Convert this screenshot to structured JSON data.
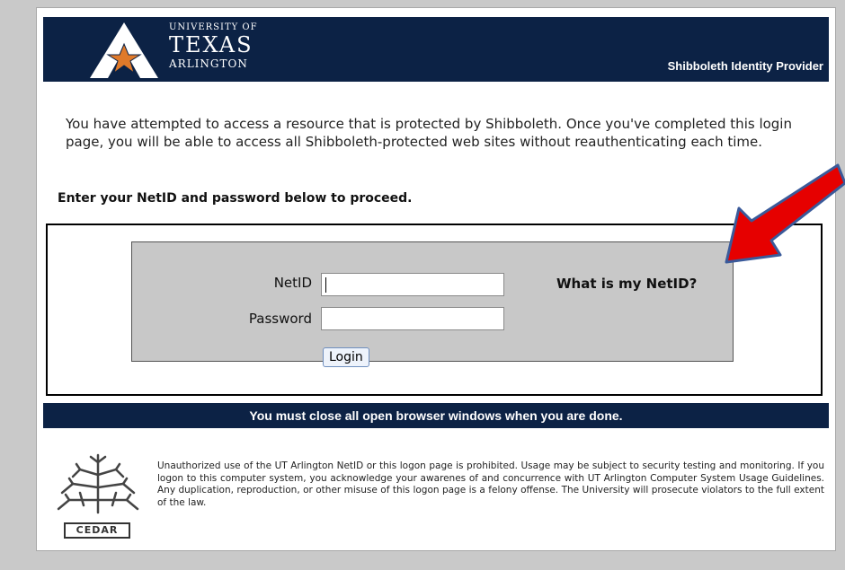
{
  "header": {
    "logo_line1": "UNIVERSITY OF",
    "logo_line2": "TEXAS",
    "logo_line3": "ARLINGTON",
    "idp_label": "Shibboleth Identity Provider"
  },
  "intro_text": "You have attempted to access a resource that is protected by Shibboleth. Once you've completed this login page, you will be able to access all Shibboleth-protected web sites without reauthenticating each time.",
  "enter_prompt": "Enter your NetID and password below to proceed.",
  "login": {
    "netid_label": "NetID",
    "netid_value": "",
    "password_label": "Password",
    "password_value": "",
    "what_is_netid": "What is my NetID?",
    "login_button": "Login"
  },
  "close_notice": "You must close all open browser windows when you are done.",
  "footer": {
    "cedar_label": "CEDAR",
    "legal_text": "Unauthorized use of the UT Arlington NetID or this logon page is prohibited. Usage may be subject to security testing and monitoring. If you logon to this computer system, you acknowledge your awarenes of and concurrence with UT Arlington Computer System Usage Guidelines. Any duplication, reproduction, or other misuse of this logon page is a felony offense. The University will prosecute violators to the full extent of the law."
  },
  "colors": {
    "header_bg": "#0c2245",
    "login_panel_bg": "#c8c8c8",
    "arrow": "#e60000",
    "star": "#e07a2a"
  },
  "icons": {
    "logo": "uta-a-star-logo",
    "cedar": "cedar-tree-logo",
    "annotation": "red-arrow-pointer"
  }
}
